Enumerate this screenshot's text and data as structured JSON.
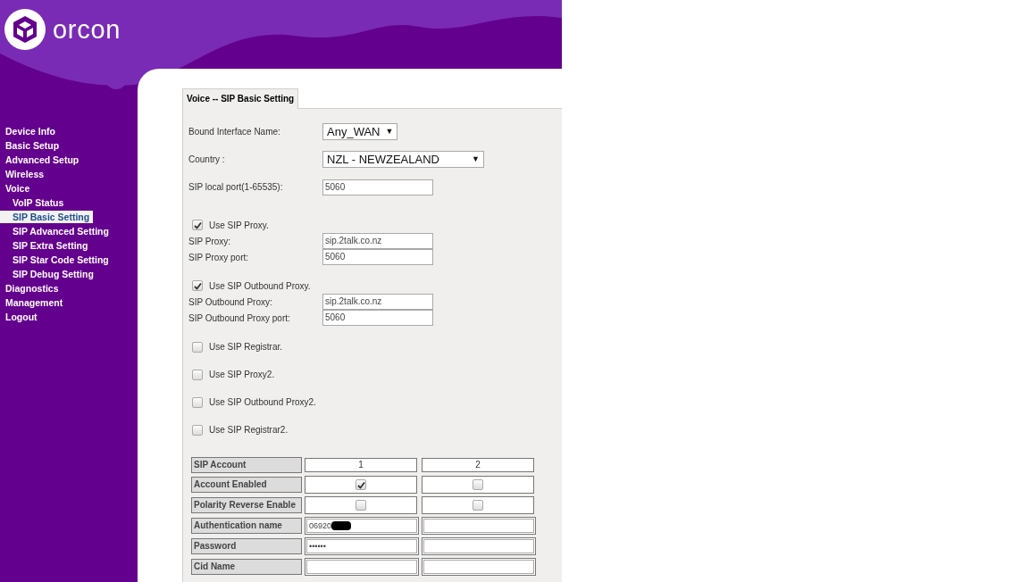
{
  "brand": {
    "name": "orcon"
  },
  "nav": [
    {
      "label": "Device Info",
      "selected": false
    },
    {
      "label": "Basic Setup",
      "selected": false
    },
    {
      "label": "Advanced Setup",
      "selected": false
    },
    {
      "label": "Wireless",
      "selected": false
    },
    {
      "label": "Voice",
      "selected": false,
      "children": [
        {
          "label": "VoIP Status",
          "selected": false
        },
        {
          "label": "SIP Basic Setting",
          "selected": true
        },
        {
          "label": "SIP Advanced Setting",
          "selected": false
        },
        {
          "label": "SIP Extra Setting",
          "selected": false
        },
        {
          "label": "SIP Star Code Setting",
          "selected": false
        },
        {
          "label": "SIP Debug Setting",
          "selected": false
        }
      ]
    },
    {
      "label": "Diagnostics",
      "selected": false
    },
    {
      "label": "Management",
      "selected": false
    },
    {
      "label": "Logout",
      "selected": false
    }
  ],
  "tab": {
    "label": "Voice -- SIP Basic Setting"
  },
  "settings": [
    {
      "kind": "select",
      "label": "Bound Interface Name:",
      "value": "Any_WAN",
      "caret": "▼"
    },
    {
      "kind": "select",
      "label": "Country :",
      "value": "NZL - NEWZEALAND",
      "caret": "▼"
    },
    {
      "kind": "text",
      "label": "SIP local port(1-65535):",
      "value": "5060"
    }
  ],
  "proxy_groups": [
    {
      "label": "Use SIP Proxy.",
      "checked": true,
      "fields": [
        {
          "label": "SIP Proxy:",
          "value": "sip.2talk.co.nz"
        },
        {
          "label": "SIP Proxy port:",
          "value": "5060"
        }
      ]
    },
    {
      "label": "Use SIP Outbound Proxy.",
      "checked": true,
      "fields": [
        {
          "label": "SIP Outbound Proxy:",
          "value": "sip.2talk.co.nz"
        },
        {
          "label": "SIP Outbound Proxy port:",
          "value": "5060"
        }
      ]
    }
  ],
  "options": [
    {
      "label": "Use SIP Registrar.",
      "checked": false
    },
    {
      "label": "Use SIP Proxy2.",
      "checked": false
    },
    {
      "label": "Use SIP Outbound Proxy2.",
      "checked": false
    },
    {
      "label": "Use SIP Registrar2.",
      "checked": false
    }
  ],
  "accounts_table": {
    "rows": [
      {
        "label": "SIP Account",
        "kind": "text",
        "cells": [
          {
            "text": "1"
          },
          {
            "text": "2"
          }
        ]
      },
      {
        "label": "Account Enabled",
        "kind": "checkbox",
        "cells": [
          {
            "checked": true
          },
          {
            "checked": false
          }
        ]
      },
      {
        "label": "Polarity Reverse Enable",
        "kind": "checkbox",
        "cells": [
          {
            "checked": false
          },
          {
            "checked": false
          }
        ]
      },
      {
        "label": "Authentication name",
        "kind": "input",
        "cells": [
          {
            "value": "06920",
            "redacted": true
          },
          {}
        ]
      },
      {
        "label": "Password",
        "kind": "input",
        "cells": [
          {
            "value": "••••••"
          },
          {}
        ]
      },
      {
        "label": "Cid Name",
        "kind": "input",
        "cells": [
          {},
          {}
        ]
      }
    ]
  }
}
